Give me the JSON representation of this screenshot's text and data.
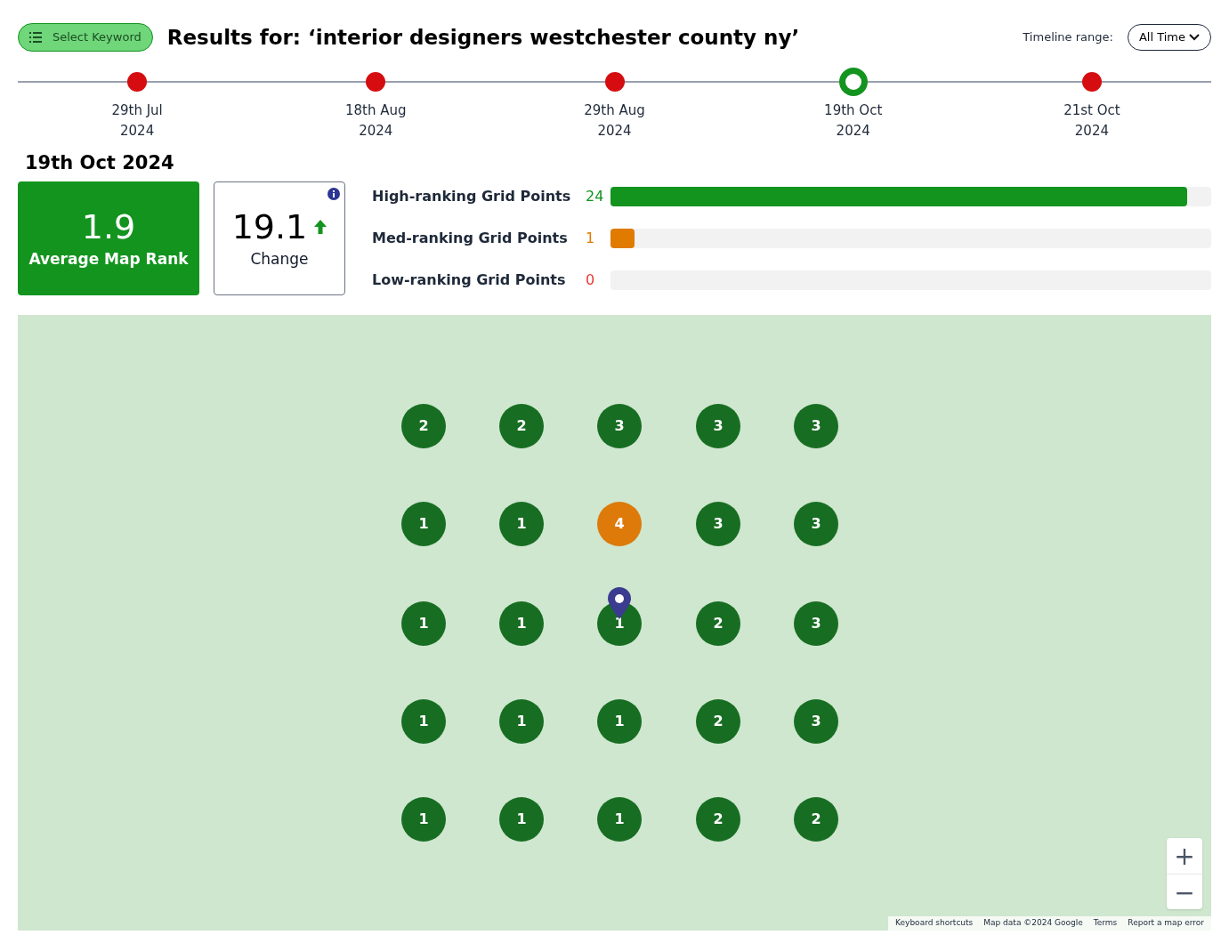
{
  "header": {
    "select_button": "Select Keyword",
    "title": "Results for: ‘interior designers westchester county ny’",
    "timeline_label": "Timeline range:",
    "timeline_range": "All Time"
  },
  "timeline": [
    {
      "day": "29th Jul",
      "year": "2024",
      "selected": false
    },
    {
      "day": "18th Aug",
      "year": "2024",
      "selected": false
    },
    {
      "day": "29th Aug",
      "year": "2024",
      "selected": false
    },
    {
      "day": "19th Oct",
      "year": "2024",
      "selected": true
    },
    {
      "day": "21st Oct",
      "year": "2024",
      "selected": false
    }
  ],
  "date_heading": "19th Oct 2024",
  "average": {
    "value": "1.9",
    "label": "Average Map Rank"
  },
  "change": {
    "value": "19.1",
    "label": "Change"
  },
  "rankings": [
    {
      "label": "High-ranking Grid Points",
      "count": "24",
      "color": "#13941f",
      "level": 0.96
    },
    {
      "label": "Med-ranking Grid Points",
      "count": "1",
      "color": "#e07b00",
      "level": 0.04
    },
    {
      "label": "Low-ranking Grid Points",
      "count": "0",
      "color": "#e53935",
      "level": 0
    }
  ],
  "map": {
    "grid": [
      [
        "2",
        "2",
        "3",
        "3",
        "3"
      ],
      [
        "1",
        "1",
        "4",
        "3",
        "3"
      ],
      [
        "1",
        "1",
        "1",
        "2",
        "3"
      ],
      [
        "1",
        "1",
        "1",
        "2",
        "3"
      ],
      [
        "1",
        "1",
        "1",
        "2",
        "2"
      ]
    ],
    "attribution": [
      "Keyboard shortcuts",
      "Map data ©2024 Google",
      "Terms",
      "Report a map error"
    ],
    "zoom_in": "+",
    "zoom_out": "−"
  }
}
